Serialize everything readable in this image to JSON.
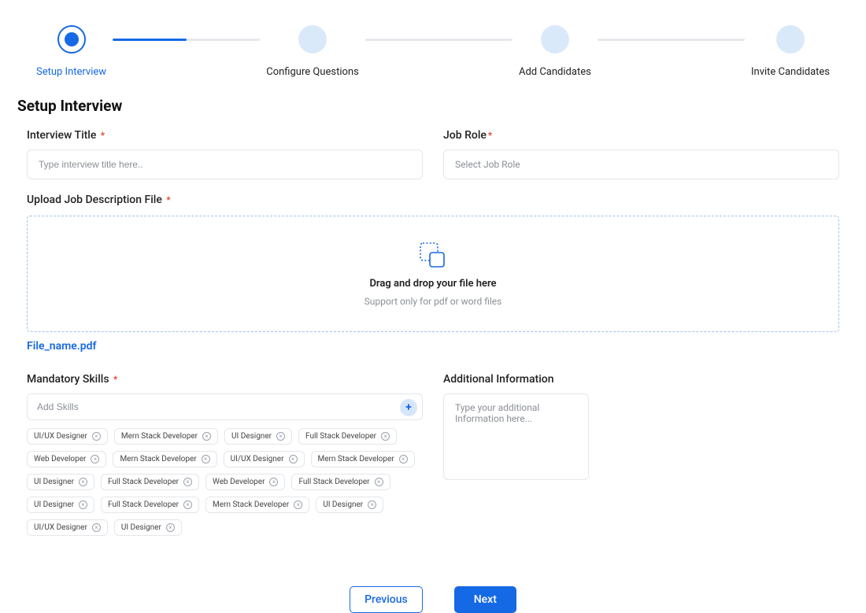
{
  "stepper": {
    "steps": [
      {
        "label": "Setup Interview",
        "state": "active"
      },
      {
        "label": "Configure Questions",
        "state": "pending"
      },
      {
        "label": "Add Candidates",
        "state": "pending"
      },
      {
        "label": "Invite Candidates",
        "state": "pending"
      }
    ],
    "progress_before_step2_percent": 50
  },
  "page_title": "Setup Interview",
  "fields": {
    "interview_title": {
      "label": "Interview Title",
      "placeholder": "Type interview title here.."
    },
    "job_role": {
      "label": "Job Role",
      "placeholder": "Select Job Role"
    },
    "upload_jd": {
      "label": "Upload Job Description File",
      "drop_title": "Drag and drop your file here",
      "drop_sub": "Support only for pdf or word files",
      "file_name": "File_name.pdf"
    },
    "mandatory_skills": {
      "label": "Mandatory Skills",
      "placeholder": "Add Skills",
      "chips": [
        "UI/UX Designer",
        "Mern Stack Developer",
        "UI Designer",
        "Full Stack Developer",
        "Web Developer",
        "Mern Stack Developer",
        "UI/UX Designer",
        "Mern Stack Developer",
        "UI Designer",
        "Full Stack Developer",
        "Web Developer",
        "Full Stack Developer",
        "UI Designer",
        "Full Stack Developer",
        "Mern Stack Developer",
        "UI Designer",
        "UI/UX Designer",
        "UI Designer"
      ]
    },
    "additional_info": {
      "label": "Additional Information",
      "placeholder": "Type your additional Information here..."
    }
  },
  "buttons": {
    "previous": "Previous",
    "next": "Next"
  }
}
